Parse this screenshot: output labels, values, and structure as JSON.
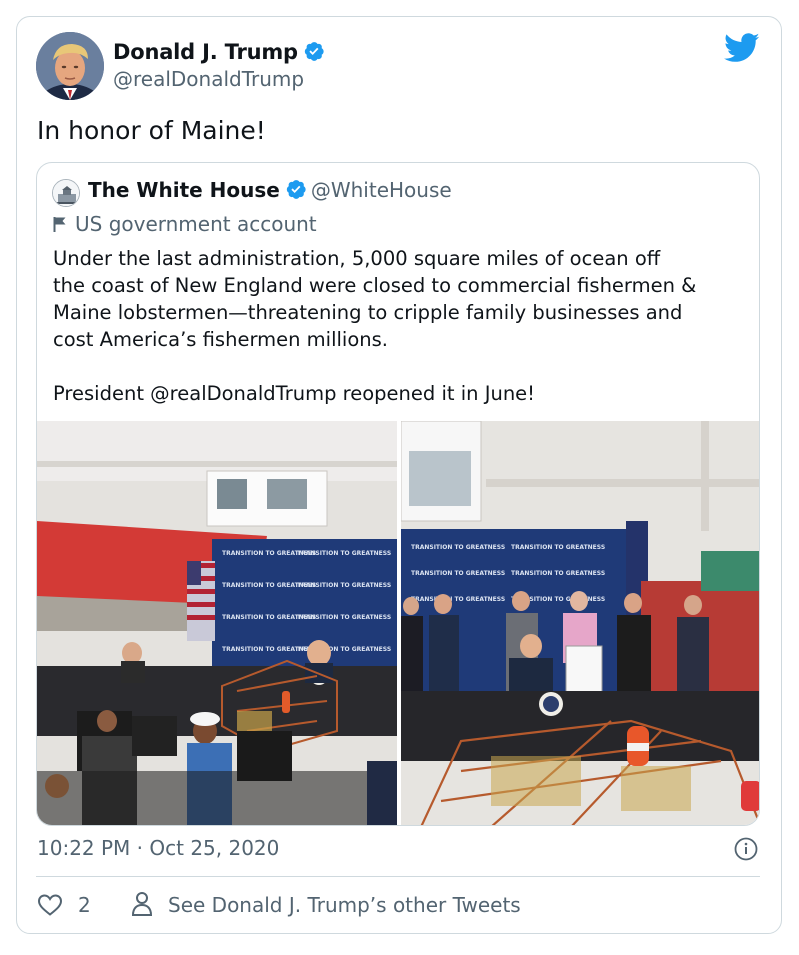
{
  "tweet": {
    "author_name": "Donald J. Trump",
    "author_handle": "@realDonaldTrump",
    "text": "In honor of Maine!",
    "timestamp": "10:22 PM · Oct 25, 2020",
    "likes": "2",
    "see_other_label": "See Donald J. Trump’s other Tweets"
  },
  "quoted_tweet": {
    "author_name": "The White House",
    "author_handle": "@WhiteHouse",
    "account_label": "US government account",
    "text": "Under the last administration, 5,000 square miles of ocean off\nthe coast of New England were closed to commercial fishermen &\nMaine lobstermen—threatening to cripple family businesses and\ncost America’s fishermen millions.\n\nPresident @realDonaldTrump reopened it in June!",
    "photo_backdrop_text": "TRANSITION TO GREATNESS"
  },
  "icons": {
    "verified": "verified-badge-icon",
    "twitter": "twitter-bird-icon",
    "flag": "flag-icon",
    "info": "info-icon",
    "like": "heart-icon",
    "profile": "person-icon"
  },
  "colors": {
    "twitter_blue": "#1d9bf0",
    "secondary_text": "#536471",
    "border": "#cfd9de"
  }
}
